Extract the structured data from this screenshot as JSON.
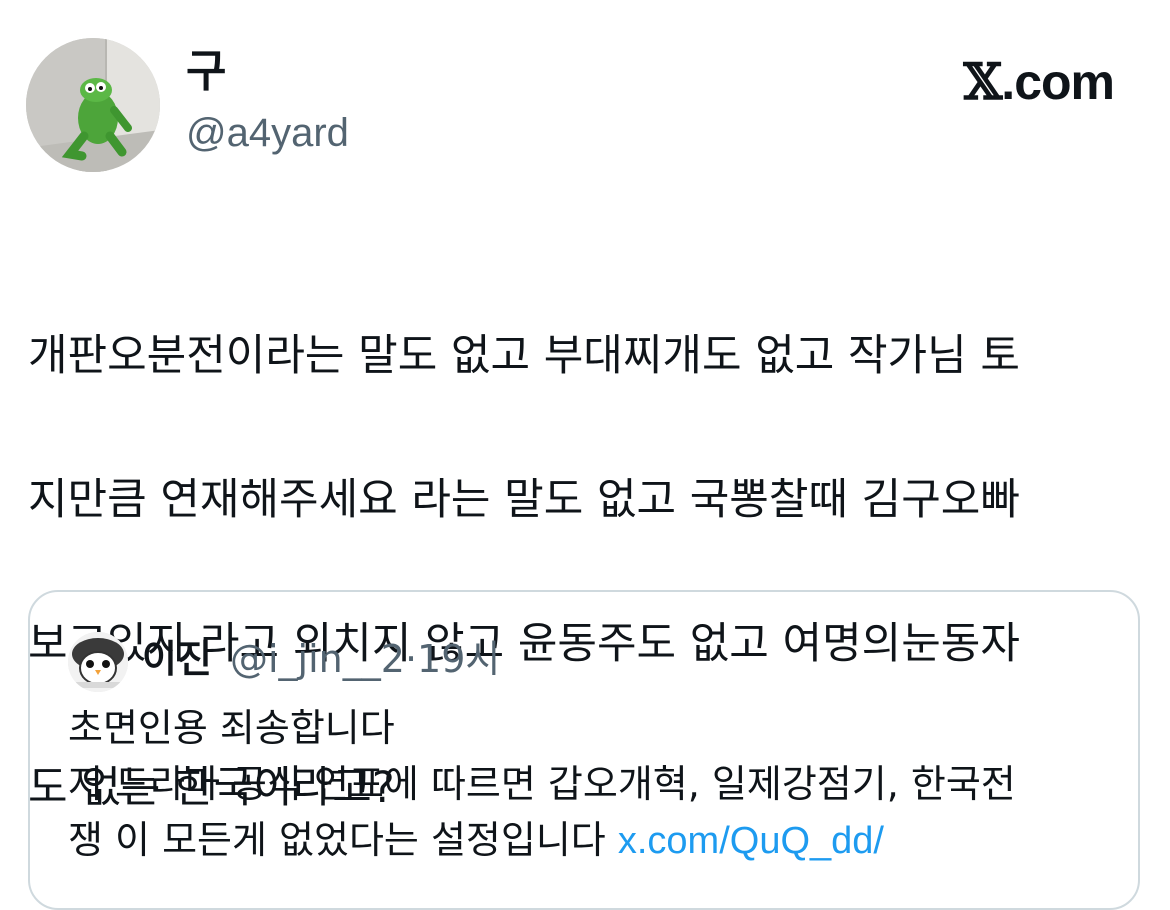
{
  "author": {
    "name": "구",
    "handle": "@a4yard",
    "avatar_icon": "kermit-frog-avatar"
  },
  "brand": {
    "text": ".com",
    "logo_glyph": "𝕏"
  },
  "tweet": {
    "lines": [
      "개판오분전이라는 말도 없고 부대찌개도 없고 작가님 토",
      "지만큼 연재해주세요 라는 말도 없고 국뽕찰때 김구오빠",
      "보고있지 라고 외치지 않고 윤동주도 없고 여명의눈동자",
      "도 없는 한국이라고?"
    ]
  },
  "quoted_tweet": {
    "name": "이진",
    "handle": "@i_jin__2",
    "separator": "·",
    "time": "19시",
    "avatar_icon": "penguin-avatar",
    "lines": [
      "초면인용 죄송합니다",
      "저 드라마 공식 연표에 따르면 갑오개혁, 일제강점기, 한국전",
      "쟁 이 모든게 없었다는 설정입니다"
    ],
    "link": "x.com/QuQ_dd/"
  },
  "colors": {
    "text": "#0f1419",
    "secondary": "#536471",
    "link": "#1d9bf0",
    "border": "#cfd9de"
  }
}
